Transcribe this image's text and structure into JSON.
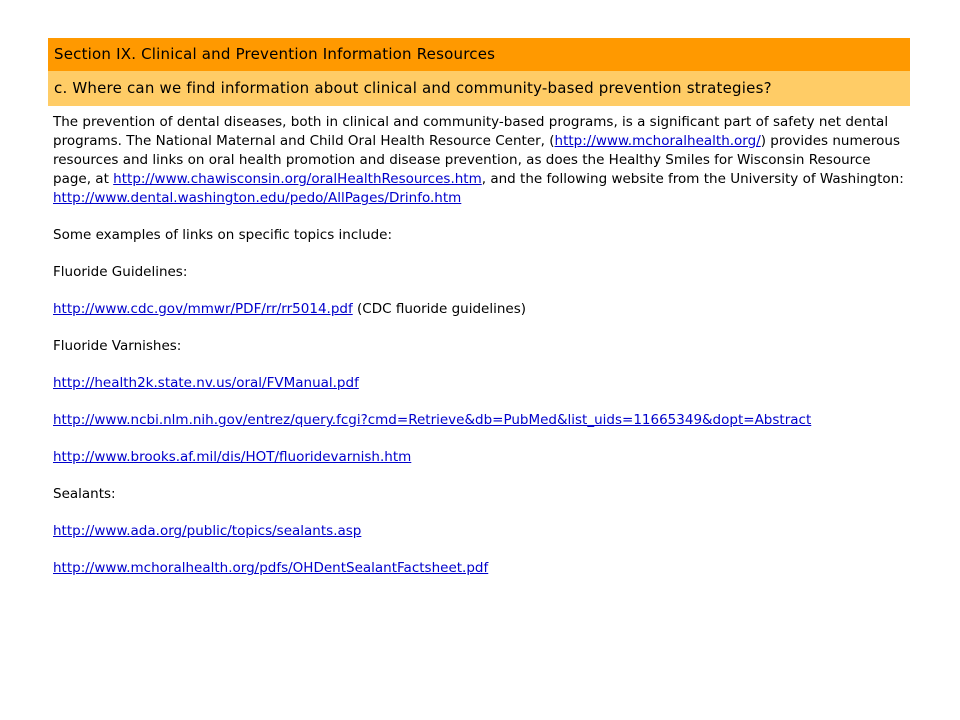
{
  "section_title": "Section IX. Clinical and Prevention Information Resources",
  "question": "c. Where can we find information about clinical and community-based prevention strategies?",
  "intro": {
    "t1": "The prevention of dental diseases, both in clinical and community-based programs, is a significant part of safety net dental programs. The National Maternal and Child Oral Health Resource Center, (",
    "link1": "http://www.mchoralhealth.org/",
    "t2": ") provides numerous resources and links on oral health promotion and disease prevention, as does the Healthy Smiles for Wisconsin Resource page, at ",
    "link2": "http://www.chawisconsin.org/oralHealthResources.htm",
    "t3": ", and the following website from the University of Washington: ",
    "link3": "http://www.dental.washington.edu/pedo/AllPages/Drinfo.htm"
  },
  "examples_intro": "Some examples of links on specific topics include:",
  "fluoride_guidelines": {
    "heading": "Fluoride Guidelines:",
    "link": "http://www.cdc.gov/mmwr/PDF/rr/rr5014.pdf",
    "note": " (CDC fluoride guidelines)"
  },
  "fluoride_varnishes": {
    "heading": "Fluoride Varnishes:",
    "links": [
      "http://health2k.state.nv.us/oral/FVManual.pdf",
      "http://www.ncbi.nlm.nih.gov/entrez/query.fcgi?cmd=Retrieve&db=PubMed&list_uids=11665349&dopt=Abstract",
      "http://www.brooks.af.mil/dis/HOT/fluoridevarnish.htm"
    ]
  },
  "sealants": {
    "heading": "Sealants:",
    "links": [
      "http://www.ada.org/public/topics/sealants.asp",
      "http://www.mchoralhealth.org/pdfs/OHDentSealantFactsheet.pdf"
    ]
  }
}
